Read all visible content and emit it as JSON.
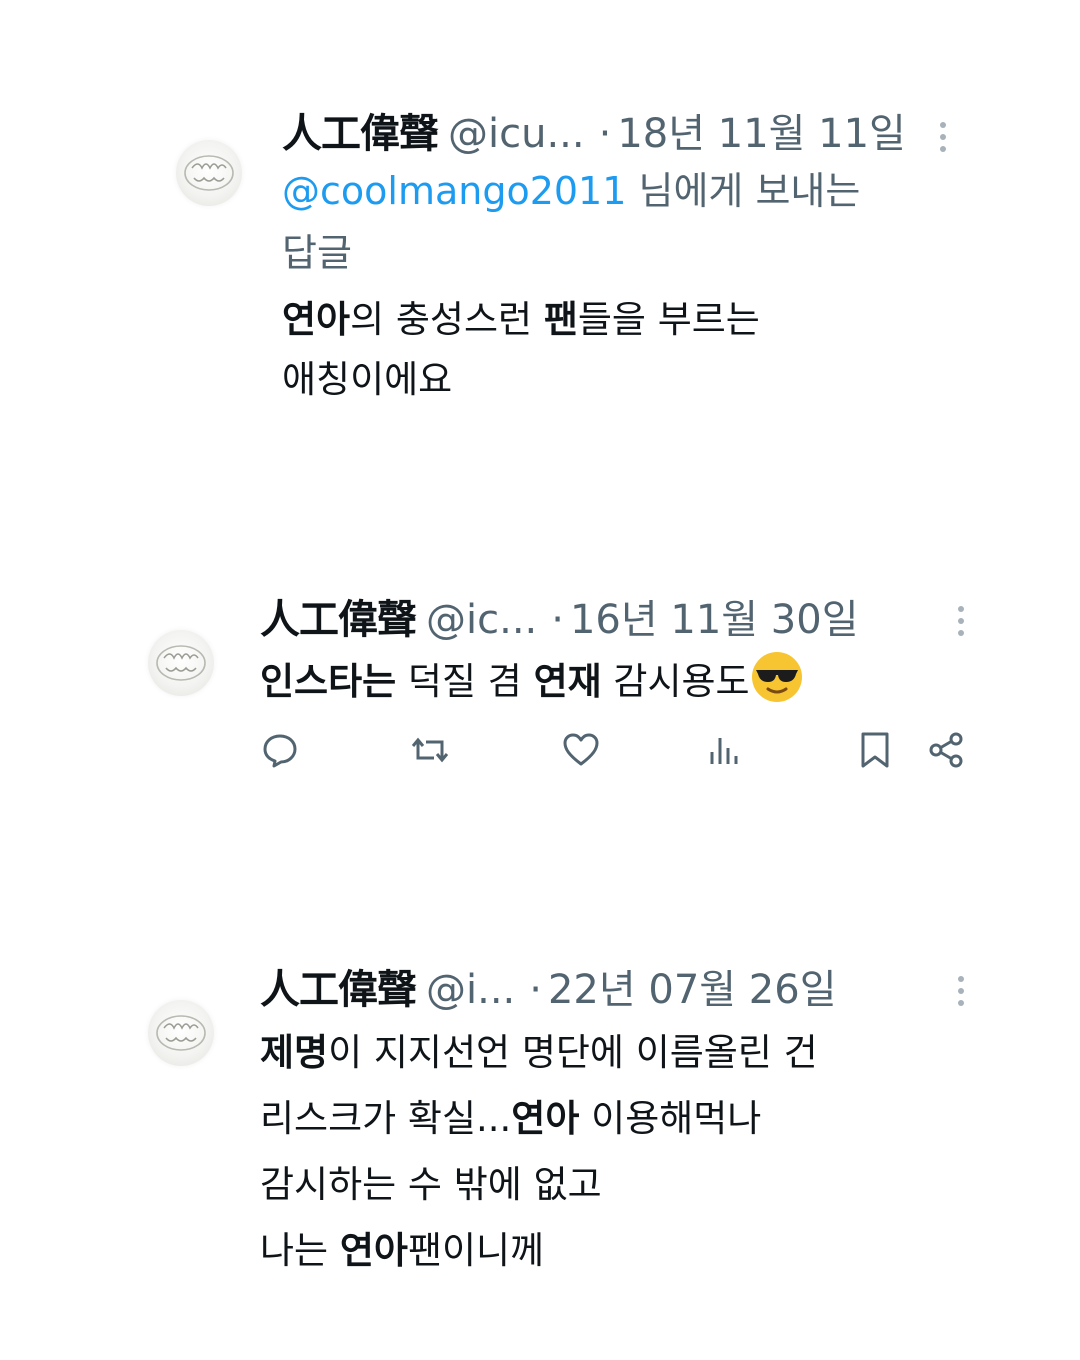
{
  "tweets": [
    {
      "name": "人工偉聲",
      "handle": "@icu...",
      "dot": "·",
      "date": "18년 11월 11일",
      "reply_prefix": "@coolmango2011",
      "reply_suffix": " 님에게 보내는",
      "reply_line2": "답글",
      "line1": [
        {
          "t": "연아",
          "b": true
        },
        {
          "t": "의 충성스런 ",
          "b": false
        },
        {
          "t": "팬",
          "b": true
        },
        {
          "t": "들을 부르는",
          "b": false
        }
      ],
      "line2": "애칭이에요"
    },
    {
      "name": "人工偉聲",
      "handle": "@ic...",
      "dot": "·",
      "date": "16년 11월 30일",
      "line1": [
        {
          "t": "인스타는",
          "b": true
        },
        {
          "t": " 덕질 겸 ",
          "b": false
        },
        {
          "t": "연재",
          "b": true
        },
        {
          "t": " 감시용도",
          "b": false
        }
      ],
      "emoji": "smiling-face-with-sunglasses"
    },
    {
      "name": "人工偉聲",
      "handle": "@i...",
      "dot": "·",
      "date": "22년 07월 26일",
      "line1": [
        {
          "t": "제명",
          "b": true
        },
        {
          "t": "이 지지선언 명단에 이름올린 건",
          "b": false
        }
      ],
      "line2": [
        {
          "t": "리스크가 확실...",
          "b": false
        },
        {
          "t": "연아",
          "b": true
        },
        {
          "t": " 이용해먹나",
          "b": false
        }
      ],
      "line3": "감시하는 수 밖에 없고",
      "line4": [
        {
          "t": "나는 ",
          "b": false
        },
        {
          "t": "연아",
          "b": true
        },
        {
          "t": "팬이니께",
          "b": false
        }
      ]
    }
  ],
  "actions": [
    "reply-icon",
    "retweet-icon",
    "like-icon",
    "views-icon",
    "bookmark-icon",
    "share-icon"
  ],
  "colors": {
    "secondary": "#536471",
    "link": "#1d9bf0",
    "text": "#0f1419"
  }
}
